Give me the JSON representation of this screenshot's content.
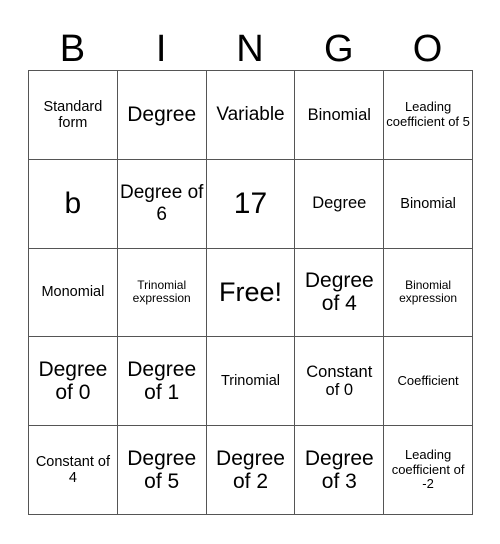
{
  "card": {
    "title": "BINGO",
    "header_letters": [
      "B",
      "I",
      "N",
      "G",
      "O"
    ],
    "columns": 5,
    "rows": 5,
    "free_space": "Free!",
    "border_color": "#555555",
    "text_color": "#000000",
    "background_color": "#ffffff",
    "cells": [
      [
        {
          "text": "Standard form",
          "size": "md"
        },
        {
          "text": "Degree",
          "size": "xxl"
        },
        {
          "text": "Variable",
          "size": "xl"
        },
        {
          "text": "Binomial",
          "size": "lg"
        },
        {
          "text": "Leading coefficient of 5",
          "size": "sm"
        }
      ],
      [
        {
          "text": "b",
          "size": "mega"
        },
        {
          "text": "Degree of 6",
          "size": "xl"
        },
        {
          "text": "17",
          "size": "mega"
        },
        {
          "text": "Degree",
          "size": "lg"
        },
        {
          "text": "Binomial",
          "size": "md"
        }
      ],
      [
        {
          "text": "Monomial",
          "size": "md"
        },
        {
          "text": "Trinomial expression",
          "size": "xs"
        },
        {
          "text": "Free!",
          "size": "huge"
        },
        {
          "text": "Degree of 4",
          "size": "xxl"
        },
        {
          "text": "Binomial expression",
          "size": "xs"
        }
      ],
      [
        {
          "text": "Degree of 0",
          "size": "xxl"
        },
        {
          "text": "Degree of 1",
          "size": "xxl"
        },
        {
          "text": "Trinomial",
          "size": "md"
        },
        {
          "text": "Constant of 0",
          "size": "lg"
        },
        {
          "text": "Coefficient",
          "size": "sm"
        }
      ],
      [
        {
          "text": "Constant of 4",
          "size": "md"
        },
        {
          "text": "Degree of 5",
          "size": "xxl"
        },
        {
          "text": "Degree of 2",
          "size": "xxl"
        },
        {
          "text": "Degree of 3",
          "size": "xxl"
        },
        {
          "text": "Leading coefficient of -2",
          "size": "sm"
        }
      ]
    ]
  }
}
